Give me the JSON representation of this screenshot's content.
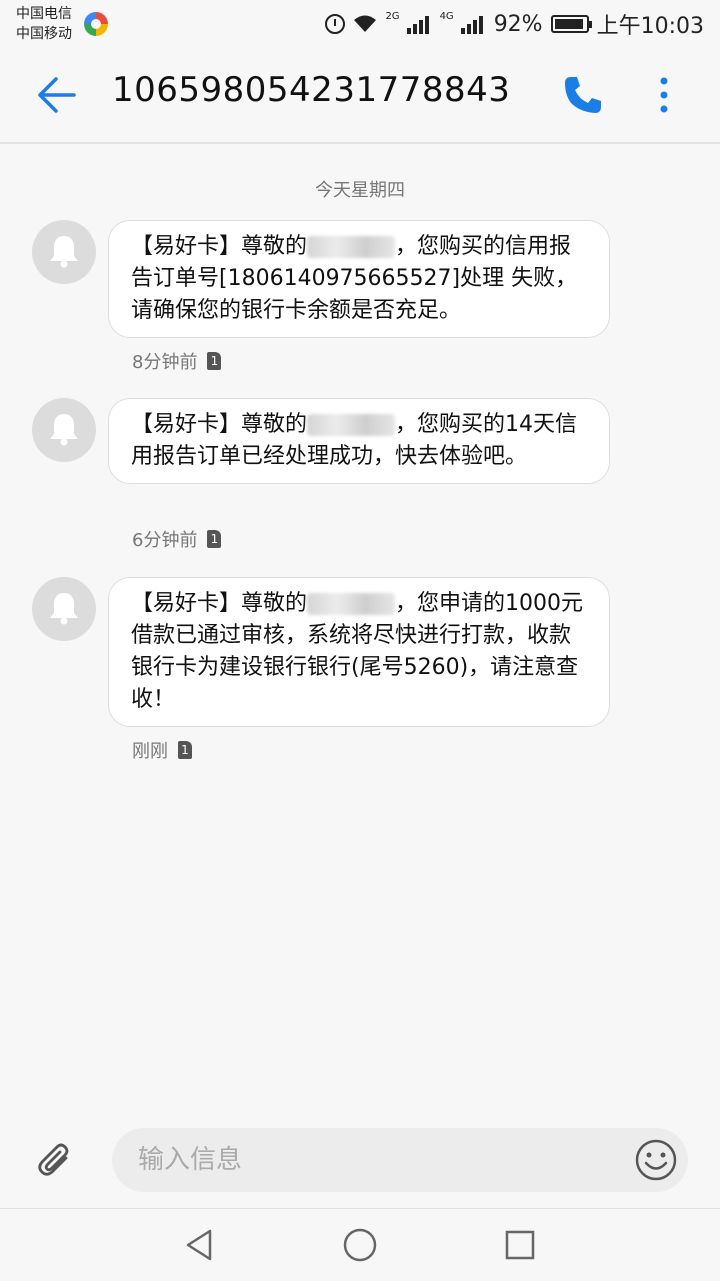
{
  "status_bar": {
    "carrier_1": "中国电信",
    "carrier_2": "中国移动",
    "network_1": "2G",
    "network_2": "4G",
    "battery": "92%",
    "battery_level": 0.92,
    "time": "上午10:03"
  },
  "header": {
    "title": "10659805423177884​3",
    "back_icon": "back-arrow-icon",
    "call_icon": "phone-icon",
    "more_icon": "more-vertical-icon"
  },
  "conversation": {
    "date_label": "今天星期四",
    "messages": [
      {
        "prefix": "【易好卡】尊敬的",
        "text": "，您购买的信用报告订单号[1806140975665527]处理 失败，请确保您的银行卡余额是否充足。",
        "time": "8分钟前",
        "sim": "1"
      },
      {
        "prefix": "【易好卡】尊敬的",
        "text": "，您购买的14天信用报告订单已经处理成功，快去体验吧。",
        "time": "6分钟前",
        "sim": "1"
      },
      {
        "prefix": "【易好卡】尊敬的",
        "text": "，您申请的1000元借款已通过审核，系统将尽快进行打款，收款银行卡为建设银行银行(尾号5260)，请注意查收！",
        "time": "刚刚",
        "sim": "1"
      }
    ]
  },
  "composer": {
    "placeholder": "输入信息"
  },
  "colors": {
    "accent": "#1a7ee6",
    "background": "#f7f7f7",
    "bubble": "#ffffff"
  }
}
